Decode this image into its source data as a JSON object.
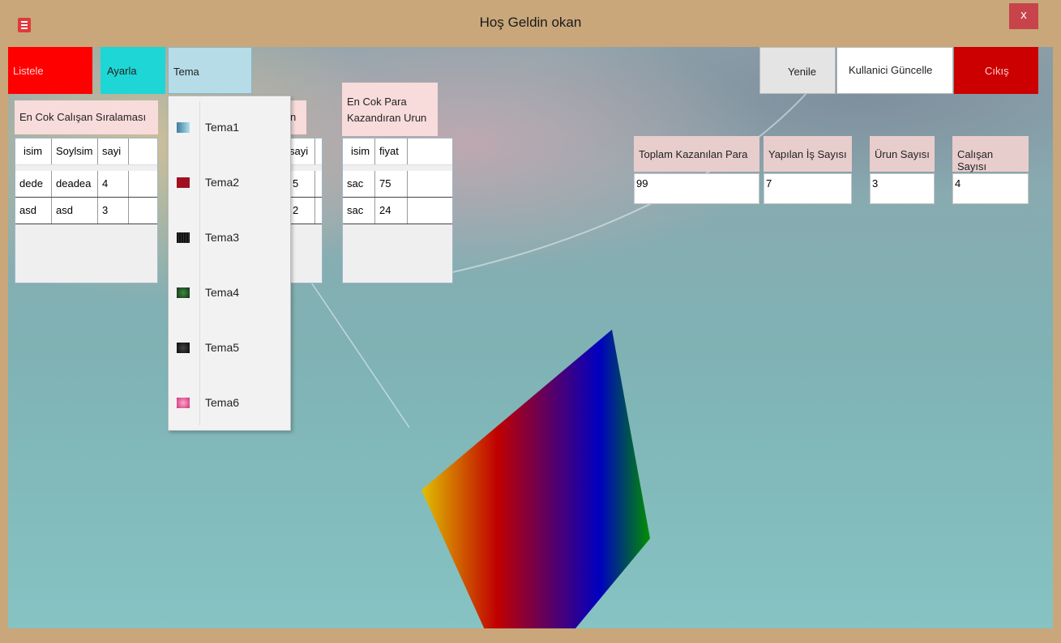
{
  "window": {
    "title": "Hoş Geldin  okan",
    "close_label": "x"
  },
  "nav": {
    "listele": "Listele",
    "ayarla": "Ayarla",
    "tema": "Tema"
  },
  "actions": {
    "yenile": "Yenile",
    "kullanici_guncelle": "Kullanici Güncelle",
    "cikis": "Cıkış"
  },
  "panels": {
    "calisan": {
      "title": "En Cok Calışan Sıralaması",
      "columns": [
        "isim",
        "Soylsim",
        "sayi"
      ],
      "rows": [
        [
          "dede",
          "deadea",
          "4"
        ],
        [
          "asd",
          "asd",
          "3"
        ]
      ]
    },
    "hidden": {
      "title_tail": "n",
      "column_tail": "sayi",
      "row_tails": [
        "5",
        "2"
      ]
    },
    "urun": {
      "title": "En Cok Para Kazandıran Urun",
      "columns": [
        "isim",
        "fiyat"
      ],
      "rows": [
        [
          "sac",
          "75"
        ],
        [
          "sac",
          "24"
        ]
      ]
    }
  },
  "stats": {
    "para": {
      "label": "Toplam Kazanılan Para",
      "value": "99"
    },
    "is": {
      "label": "Yapılan İş Sayısı",
      "value": "7"
    },
    "urun": {
      "label": "Ürun Sayısı",
      "value": "3"
    },
    "calisan": {
      "label": "Calışan Sayısı",
      "value": "4"
    }
  },
  "theme_menu": [
    {
      "label": "Tema1",
      "icon": "theme1-swatch-icon",
      "color": "#6aa6c4"
    },
    {
      "label": "Tema2",
      "icon": "theme2-swatch-icon",
      "color": "#a01020"
    },
    {
      "label": "Tema3",
      "icon": "theme3-swatch-icon",
      "color": "#1a1a1a"
    },
    {
      "label": "Tema4",
      "icon": "theme4-swatch-icon",
      "color": "#1f4a22"
    },
    {
      "label": "Tema5",
      "icon": "theme5-swatch-icon",
      "color": "#121212"
    },
    {
      "label": "Tema6",
      "icon": "theme6-swatch-icon",
      "color": "#e0609a"
    }
  ],
  "colors": {
    "red": "#ff0000",
    "cyan": "#1ed6d6",
    "tema": "#b6dce8",
    "cikis": "#cc0000",
    "pink_label": "#f8dbdb"
  }
}
